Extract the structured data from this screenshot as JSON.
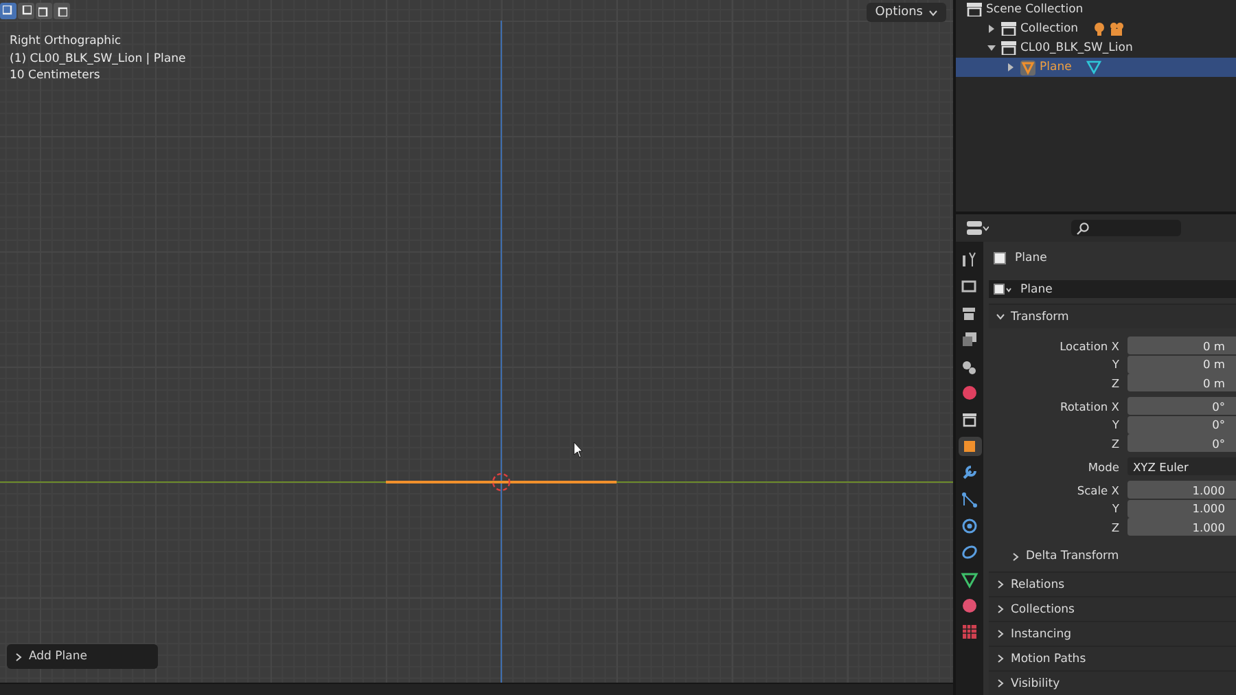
{
  "viewport": {
    "select_modes": [
      {
        "selected": true
      },
      {
        "selected": false
      },
      {
        "selected": false
      },
      {
        "selected": false
      }
    ],
    "options_button": "Options",
    "overlay_lines": [
      "Right Orthographic",
      "(1) CL00_BLK_SW_Lion | Plane",
      "10 Centimeters"
    ],
    "last_operator": {
      "label": "Add Plane",
      "expanded": false
    }
  },
  "outliner": {
    "items": [
      {
        "label": "Scene Collection",
        "kind": "scene-collection",
        "selected": false,
        "children": [
          {
            "label": "Collection",
            "kind": "collection",
            "expanded": false,
            "selected": false,
            "contents": [
              {
                "kind": "light"
              },
              {
                "kind": "camera"
              }
            ]
          },
          {
            "label": "CL00_BLK_SW_Lion",
            "kind": "collection",
            "expanded": true,
            "selected": false,
            "children": [
              {
                "label": "Plane",
                "kind": "mesh-object",
                "expanded": false,
                "selected": true,
                "contents": [
                  {
                    "kind": "mesh"
                  }
                ]
              }
            ]
          }
        ]
      }
    ]
  },
  "properties": {
    "tabs": [
      {
        "kind": "tool",
        "selected": false
      },
      {
        "kind": "render",
        "selected": false
      },
      {
        "kind": "output",
        "selected": false
      },
      {
        "kind": "view-layer",
        "selected": false
      },
      {
        "kind": "scene",
        "selected": false
      },
      {
        "kind": "world",
        "selected": false
      },
      {
        "kind": "collection",
        "selected": false
      },
      {
        "kind": "object",
        "selected": true
      },
      {
        "kind": "modifiers",
        "selected": false
      },
      {
        "kind": "particles",
        "selected": false
      },
      {
        "kind": "physics",
        "selected": false
      },
      {
        "kind": "constraints",
        "selected": false
      },
      {
        "kind": "data",
        "selected": false
      },
      {
        "kind": "material",
        "selected": false
      },
      {
        "kind": "texture",
        "selected": false
      }
    ],
    "context": "Plane",
    "object_name": "Plane",
    "transform": {
      "label": "Transform",
      "expanded": true,
      "groups": [
        [
          {
            "label": "Location X",
            "value": "0 m",
            "kind": "number"
          },
          {
            "label": "Y",
            "value": "0 m",
            "kind": "number"
          },
          {
            "label": "Z",
            "value": "0 m",
            "kind": "number"
          }
        ],
        [
          {
            "label": "Rotation X",
            "value": "0°",
            "kind": "number"
          },
          {
            "label": "Y",
            "value": "0°",
            "kind": "number"
          },
          {
            "label": "Z",
            "value": "0°",
            "kind": "number"
          }
        ],
        [
          {
            "label": "Mode",
            "value": "XYZ Euler",
            "kind": "enum"
          }
        ],
        [
          {
            "label": "Scale X",
            "value": "1.000",
            "kind": "number"
          },
          {
            "label": "Y",
            "value": "1.000",
            "kind": "number"
          },
          {
            "label": "Z",
            "value": "1.000",
            "kind": "number"
          }
        ]
      ]
    },
    "panels": [
      {
        "label": "Delta Transform",
        "kind": "subpanel",
        "expanded": false
      },
      {
        "label": "Relations",
        "kind": "panel",
        "expanded": false
      },
      {
        "label": "Collections",
        "kind": "panel",
        "expanded": false
      },
      {
        "label": "Instancing",
        "kind": "panel",
        "expanded": false
      },
      {
        "label": "Motion Paths",
        "kind": "panel",
        "expanded": false
      },
      {
        "label": "Visibility",
        "kind": "panel",
        "expanded": false
      }
    ]
  }
}
